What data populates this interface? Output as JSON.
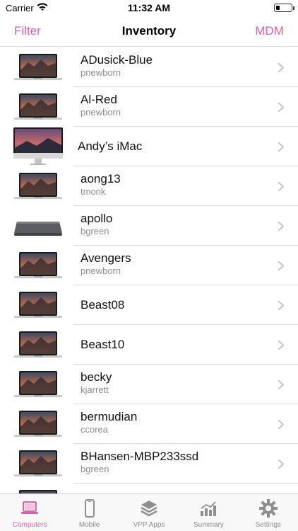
{
  "status_bar": {
    "carrier": "Carrier",
    "time": "11:32 AM"
  },
  "nav": {
    "left": "Filter",
    "title": "Inventory",
    "right": "MDM"
  },
  "accent": "#e15fa6",
  "rows": [
    {
      "name": "ADusick-Blue",
      "user": "pnewborn",
      "device": "macbook-icon"
    },
    {
      "name": "Al-Red",
      "user": "pnewborn",
      "device": "macbook-icon"
    },
    {
      "name": "Andy’s iMac",
      "user": "",
      "device": "imac-icon"
    },
    {
      "name": "aong13",
      "user": "tmonk",
      "device": "macbook-icon"
    },
    {
      "name": "apollo",
      "user": "bgreen",
      "device": "mac-mini-icon"
    },
    {
      "name": "Avengers",
      "user": "pnewborn",
      "device": "macbook-icon"
    },
    {
      "name": "Beast08",
      "user": "",
      "device": "macbook-icon"
    },
    {
      "name": "Beast10",
      "user": "",
      "device": "macbook-icon"
    },
    {
      "name": "becky",
      "user": "kjarrett",
      "device": "macbook-icon"
    },
    {
      "name": "bermudian",
      "user": "ccorea",
      "device": "macbook-icon"
    },
    {
      "name": "BHansen-MBP233ssd",
      "user": "bgreen",
      "device": "macbook-icon"
    },
    {
      "name": "",
      "user": "",
      "device": "macbook-icon"
    }
  ],
  "tabs": [
    {
      "label": "Computers",
      "icon": "laptop-icon",
      "active": true
    },
    {
      "label": "Mobile",
      "icon": "phone-icon",
      "active": false
    },
    {
      "label": "VPP Apps",
      "icon": "layers-icon",
      "active": false
    },
    {
      "label": "Summary",
      "icon": "bar-chart-icon",
      "active": false
    },
    {
      "label": "Settings",
      "icon": "gear-icon",
      "active": false
    }
  ]
}
